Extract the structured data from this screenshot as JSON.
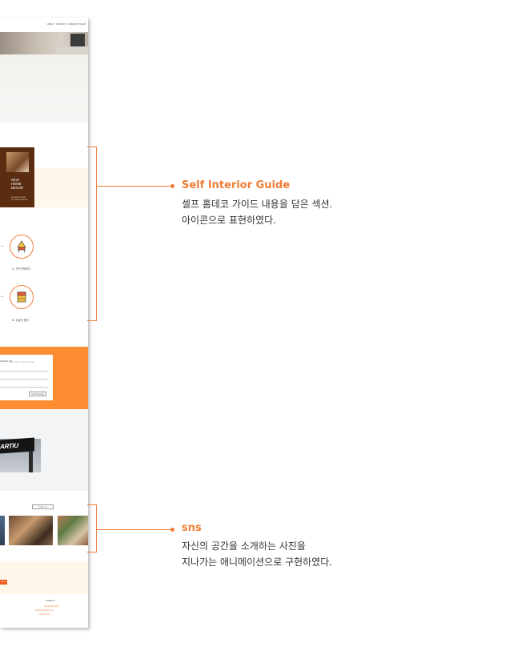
{
  "nav": {
    "items": [
      "ABOUT",
      "PRODUCT",
      "COMMUNITY",
      "SHOP"
    ]
  },
  "book": {
    "lines": [
      "SELF",
      "HOME",
      "DECOR"
    ],
    "subtitle": "BECOME AN EXPERT\nAT HOME DECORATING"
  },
  "steps": [
    {
      "label": "3. 가구선택하기",
      "icon": "lamp-icon"
    },
    {
      "label": "6. 수납과 정리",
      "icon": "drawer-icon"
    }
  ],
  "contact_form": {
    "title": "Contact Us!",
    "subtitle": "궁금하신 점이나 문의사항을 남겨주세요",
    "button": "Send Message"
  },
  "partner_logo": {
    "text": "ARTIU"
  },
  "sns_section": {
    "follow_button": "Follow Us"
  },
  "footer": {
    "button": "Sign Up",
    "lines": [
      "Contact Us",
      "TEL 02-000-0000",
      "self-home@sharp.com",
      "Seoul, Korea"
    ]
  },
  "annotations": [
    {
      "title": "Self Interior Guide",
      "lines": [
        "셀프 홈데코 가이드 내용을 담은 섹션.",
        "아이콘으로 표현하였다."
      ]
    },
    {
      "title": "sns",
      "lines": [
        "자신의 공간을 소개하는 사진을",
        "지나가는 애니메이션으로 구현하였다."
      ]
    }
  ],
  "colors": {
    "accent": "#f07d36",
    "orange_section": "#fd8d31",
    "cream": "#fff7ea"
  }
}
